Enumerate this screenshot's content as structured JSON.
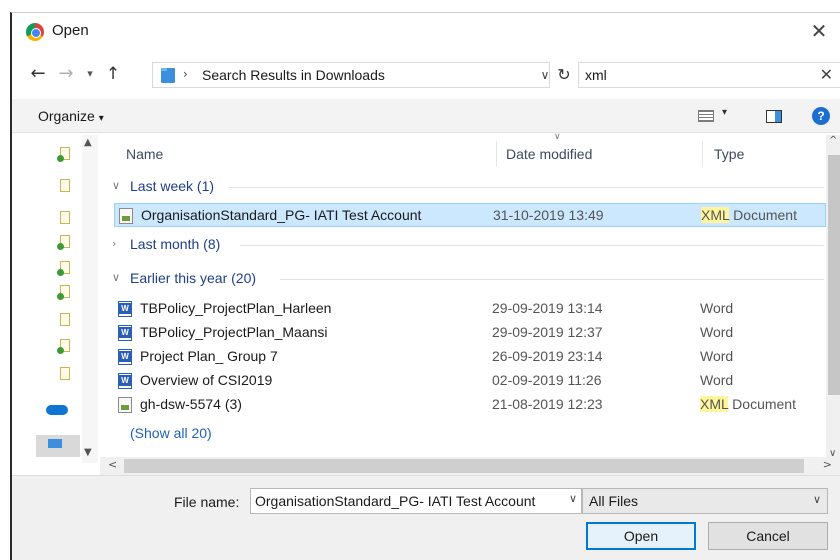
{
  "window": {
    "title": "Open"
  },
  "nav": {
    "address": "Search Results in Downloads",
    "search_value": "xml"
  },
  "toolbar": {
    "organize_label": "Organize"
  },
  "columns": {
    "name": "Name",
    "date": "Date modified",
    "type": "Type"
  },
  "groups": [
    {
      "label": "Last week (1)",
      "expanded": true
    },
    {
      "label": "Last month (8)",
      "expanded": false
    },
    {
      "label": "Earlier this year (20)",
      "expanded": true
    }
  ],
  "files": [
    {
      "name": "OrganisationStandard_PG- IATI Test Account",
      "date": "31-10-2019 13:49",
      "type_hl": "XML",
      "type_rest": " Document",
      "icon": "xml-file-icon",
      "selected": true
    },
    {
      "name": "TBPolicy_ProjectPlan_Harleen",
      "date": "29-09-2019 13:14",
      "type_hl": "",
      "type_rest": "Word",
      "icon": "word-file-icon"
    },
    {
      "name": "TBPolicy_ProjectPlan_Maansi",
      "date": "29-09-2019 12:37",
      "type_hl": "",
      "type_rest": "Word",
      "icon": "word-file-icon"
    },
    {
      "name": "Project Plan_ Group 7",
      "date": "26-09-2019 23:14",
      "type_hl": "",
      "type_rest": "Word",
      "icon": "word-file-icon"
    },
    {
      "name": "Overview of CSI2019",
      "date": "02-09-2019 11:26",
      "type_hl": "",
      "type_rest": "Word",
      "icon": "word-file-icon"
    },
    {
      "name": "gh-dsw-5574 (3)",
      "date": "21-08-2019 12:23",
      "type_hl": "XML",
      "type_rest": " Document",
      "icon": "xml-file-icon"
    }
  ],
  "show_all": "(Show all 20)",
  "footer": {
    "file_name_label": "File name:",
    "file_name_value": "OrganisationStandard_PG- IATI Test Account",
    "file_type": "All Files",
    "open_label": "Open",
    "cancel_label": "Cancel"
  },
  "colors": {
    "selection": "#cce8ff",
    "highlight": "#fff59d",
    "link": "#1d62b8",
    "accent": "#0078d7"
  }
}
